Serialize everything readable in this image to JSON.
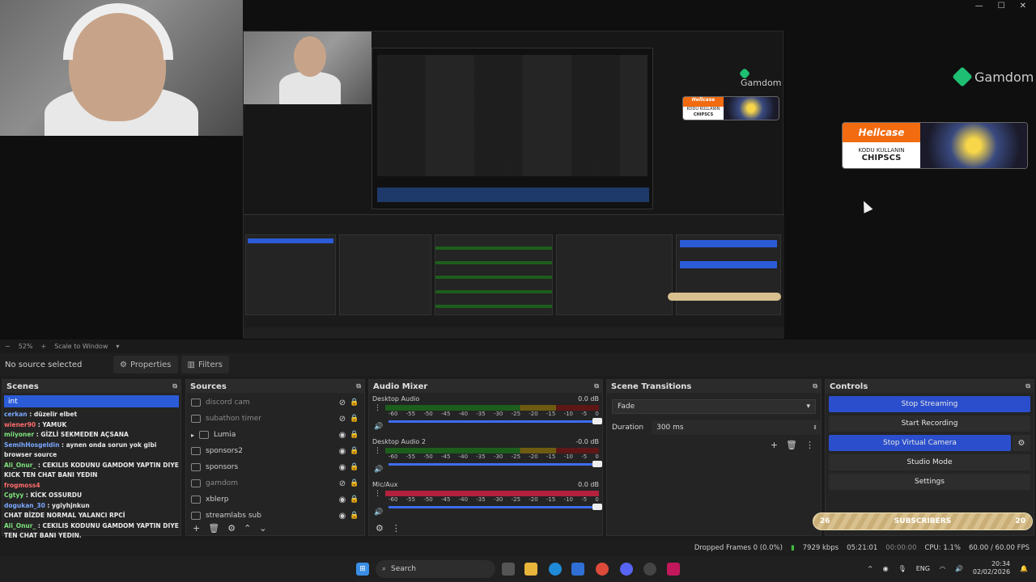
{
  "window": {
    "minimize": "—",
    "maximize": "☐",
    "close": "✕"
  },
  "overlay": {
    "brand": "Gamdom",
    "promo": {
      "brand": "Hellcase",
      "line1": "KODU KULLANIN",
      "line2": "CHIPSCS"
    }
  },
  "preview_toolbar": {
    "zoom": "52%",
    "scale_mode": "Scale to Window"
  },
  "selection_bar": {
    "no_source": "No source selected",
    "properties": "Properties",
    "filters": "Filters"
  },
  "scenes": {
    "title": "Scenes",
    "selected": "int",
    "chat": [
      {
        "user": "cerkan",
        "text": "düzelir elbet"
      },
      {
        "user": "wiener90",
        "text": "YAMUK"
      },
      {
        "user": "miiyoner",
        "text": "GİZLİ SEKMEDEN AÇSANA"
      },
      {
        "user": "SemihHosgeldin",
        "text": "aynen onda sorun yok gibi"
      },
      {
        "user": "",
        "text": "browser source"
      },
      {
        "user": "Ali_Onur_",
        "text": "CEKILIS KODUNU GAMDOM YAPTIN DIYE"
      },
      {
        "user": "",
        "text": "KICK TEN CHAT BANI YEDIN"
      },
      {
        "user": "frogmoss4",
        "text": ""
      },
      {
        "user": "Cgtyy",
        "text": "KİCK OSSURDU"
      },
      {
        "user": "dogukan_30",
        "text": "ygiyhjnkun"
      },
      {
        "user": "",
        "text": "CHAT BİZDE NORMAL YALANCI RPCİ"
      },
      {
        "user": "Ali_Onur_",
        "text": "CEKILIS KODUNU GAMDOM YAPTIN DIYE KICK"
      },
      {
        "user": "",
        "text": "TEN CHAT BANI YEDIN."
      }
    ]
  },
  "sources": {
    "title": "Sources",
    "items": [
      {
        "name": "discord cam",
        "visible": false,
        "icon": "window-icon"
      },
      {
        "name": "subathon timer",
        "visible": false,
        "icon": "globe-icon"
      },
      {
        "name": "Lumia",
        "visible": true,
        "icon": "folder-icon"
      },
      {
        "name": "sponsors2",
        "visible": true,
        "icon": "globe-icon"
      },
      {
        "name": "sponsors",
        "visible": true,
        "icon": "globe-icon"
      },
      {
        "name": "gamdom",
        "visible": false,
        "icon": "globe-icon"
      },
      {
        "name": "xblerp",
        "visible": true,
        "icon": "globe-icon"
      },
      {
        "name": "streamlabs sub",
        "visible": true,
        "icon": "globe-icon"
      }
    ]
  },
  "audio_mixer": {
    "title": "Audio Mixer",
    "ticks": [
      "-60",
      "-55",
      "-50",
      "-45",
      "-40",
      "-35",
      "-30",
      "-25",
      "-20",
      "-15",
      "-10",
      "-5",
      "0"
    ],
    "channels": [
      {
        "name": "Desktop Audio",
        "level": "0.0 dB",
        "style": "green"
      },
      {
        "name": "Desktop Audio 2",
        "level": "-0.0 dB",
        "style": "green"
      },
      {
        "name": "Mic/Aux",
        "level": "0.0 dB",
        "style": "red"
      }
    ]
  },
  "transitions": {
    "title": "Scene Transitions",
    "type": "Fade",
    "duration_label": "Duration",
    "duration": "300 ms"
  },
  "controls": {
    "title": "Controls",
    "stop_streaming": "Stop Streaming",
    "start_recording": "Start Recording",
    "stop_virtual_camera": "Stop Virtual Camera",
    "studio_mode": "Studio Mode",
    "settings": "Settings"
  },
  "subscribers_bar": {
    "label": "SUBSCRIBERS",
    "left": "26",
    "right": "20"
  },
  "status": {
    "dropped_frames": "Dropped Frames 0 (0.0%)",
    "bitrate": "7929 kbps",
    "stream_time": "05:21:01",
    "rec_time": "00:00:00",
    "cpu": "CPU: 1.1%",
    "fps": "60.00 / 60.00 FPS"
  },
  "taskbar": {
    "search": "Search",
    "lang": "ENG",
    "time": "20:34",
    "date": "02/02/2026"
  },
  "colors": {
    "accent_blue": "#2b4fcc",
    "obs_bg": "#242424"
  }
}
